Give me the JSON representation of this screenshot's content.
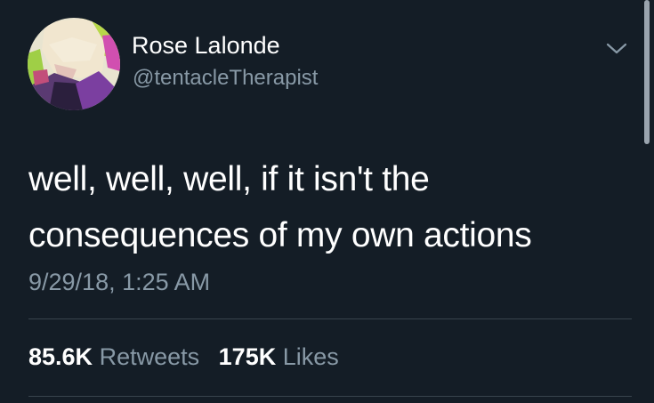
{
  "tweet": {
    "display_name": "Rose Lalonde",
    "handle": "@tentacleTherapist",
    "avatar_icon": "profile-avatar",
    "menu_icon": "chevron-down-icon",
    "text_lines": [
      "well, well, well, if it isn't the",
      "consequences of my own actions"
    ],
    "timestamp": "9/29/18, 1:25 AM",
    "stats": {
      "retweets_count": "85.6K",
      "retweets_label": "Retweets",
      "likes_count": "175K",
      "likes_label": "Likes"
    }
  },
  "colors": {
    "background": "#141d26",
    "primary_text": "#ffffff",
    "secondary_text": "#8899a6",
    "divider": "#38444d"
  }
}
